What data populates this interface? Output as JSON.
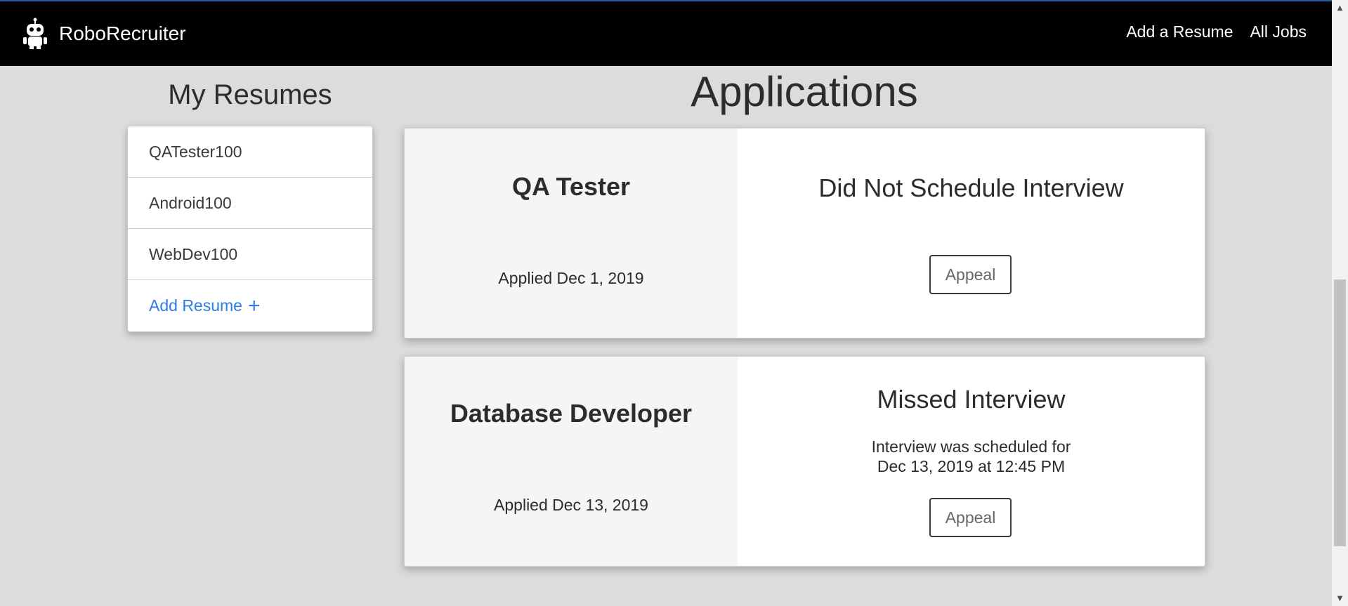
{
  "navbar": {
    "brand": "RoboRecruiter",
    "links": [
      "Add a Resume",
      "All Jobs"
    ]
  },
  "resumes": {
    "title": "My Resumes",
    "items": [
      "QATester100",
      "Android100",
      "WebDev100"
    ],
    "add_label": "Add Resume",
    "add_icon": "plus-icon"
  },
  "applications": {
    "title": "Applications",
    "items": [
      {
        "job_title": "QA Tester",
        "applied": "Applied Dec 1, 2019",
        "status": "Did Not Schedule Interview",
        "detail_line1": "",
        "detail_line2": "",
        "button": "Appeal"
      },
      {
        "job_title": "Database Developer",
        "applied": "Applied Dec 13, 2019",
        "status": "Missed Interview",
        "detail_line1": "Interview was scheduled for",
        "detail_line2": "Dec 13, 2019 at 12:45 PM",
        "button": "Appeal"
      }
    ]
  },
  "colors": {
    "navbar_bg": "#000000",
    "page_bg": "#dcdcdc",
    "link_blue": "#2d7be5"
  }
}
